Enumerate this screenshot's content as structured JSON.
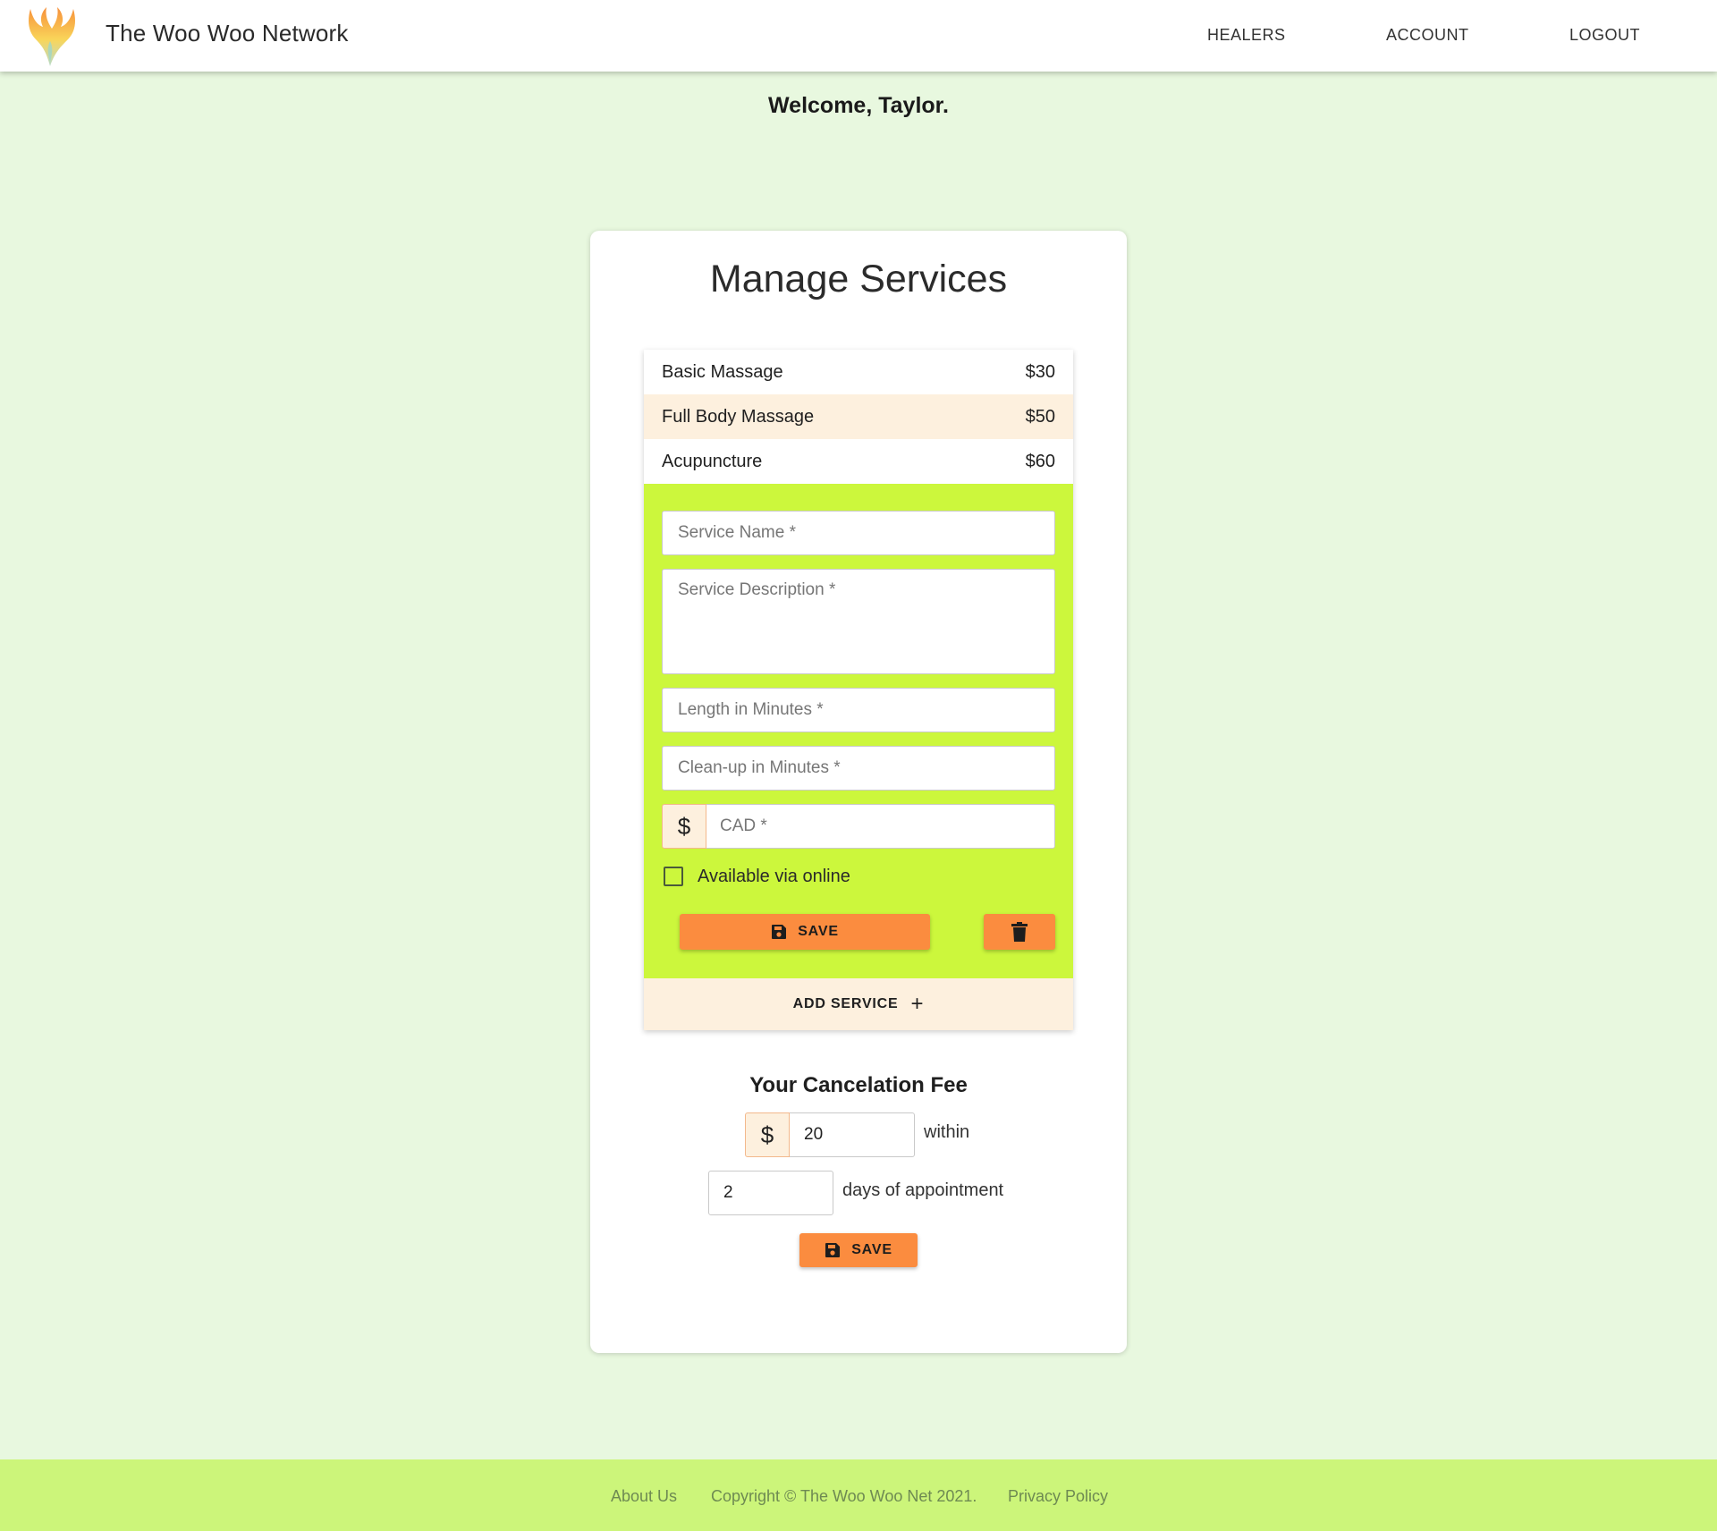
{
  "header": {
    "brand": "The Woo Woo Network",
    "nav": {
      "healers": "HEALERS",
      "account": "ACCOUNT",
      "logout": "LOGOUT"
    }
  },
  "welcome": "Welcome, Taylor.",
  "manage": {
    "title": "Manage Services",
    "services": [
      {
        "name": "Basic Massage",
        "price": "$30"
      },
      {
        "name": "Full Body Massage",
        "price": "$50"
      },
      {
        "name": "Acupuncture",
        "price": "$60"
      }
    ],
    "form": {
      "service_name_placeholder": "Service Name *",
      "service_description_placeholder": "Service Description *",
      "length_placeholder": "Length in Minutes *",
      "cleanup_placeholder": "Clean-up in Minutes *",
      "currency_symbol": "$",
      "price_placeholder": "CAD *",
      "online_label": "Available via online",
      "save_label": "SAVE"
    },
    "add_service_label": "ADD SERVICE",
    "add_service_icon": "+"
  },
  "cancellation": {
    "title": "Your Cancelation Fee",
    "currency_symbol": "$",
    "fee_value": "20",
    "within_label": "within",
    "days_value": "2",
    "days_label": "days of appointment",
    "save_label": "SAVE"
  },
  "footer": {
    "about": "About Us",
    "copyright": "Copyright © The Woo Woo Net 2021.",
    "privacy": "Privacy Policy"
  },
  "colors": {
    "page_bg": "#e8f8df",
    "form_bg": "#ccf73c",
    "accent_orange": "#fb8c3f",
    "highlight": "#fdf0de",
    "footer_bg": "#ccf57a"
  }
}
